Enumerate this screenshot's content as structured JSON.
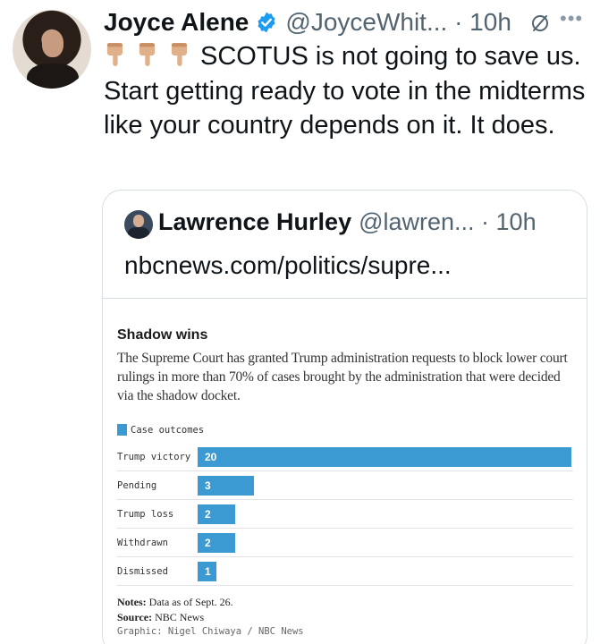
{
  "tweet": {
    "display_name": "Joyce Alene",
    "handle_time": "@JoyceWhit... · 10h",
    "text": "SCOTUS is not going to save us. Start getting ready to vote in the midterms like your country depends on it. It does.",
    "emoji_count": 3
  },
  "quote": {
    "display_name": "Lawrence Hurley",
    "handle_time": "@lawren... · 10h",
    "link_text": "nbcnews.com/politics/supre..."
  },
  "graphic": {
    "title": "Shadow wins",
    "subtitle": "The Supreme Court has granted Trump administration requests to block lower court rulings in more than 70% of cases brought by the administration that were decided via the shadow docket.",
    "legend_label": "Case outcomes",
    "notes_label": "Notes:",
    "notes_text": "Data as of Sept. 26.",
    "source_label": "Source:",
    "source_text": "NBC News",
    "credit": "Graphic: Nigel Chiwaya / NBC News"
  },
  "chart_data": {
    "type": "bar",
    "orientation": "horizontal",
    "title": "Shadow wins",
    "categories": [
      "Trump victory",
      "Pending",
      "Trump loss",
      "Withdrawn",
      "Dismissed"
    ],
    "series": [
      {
        "name": "Case outcomes",
        "values": [
          20,
          3,
          2,
          2,
          1
        ]
      }
    ],
    "xlim": [
      0,
      20
    ],
    "legend": "top-left",
    "bar_color": "#3a9ad1"
  },
  "colors": {
    "verified": "#1d9bf0",
    "secondary_text": "#536471",
    "bar": "#3a9ad1"
  }
}
